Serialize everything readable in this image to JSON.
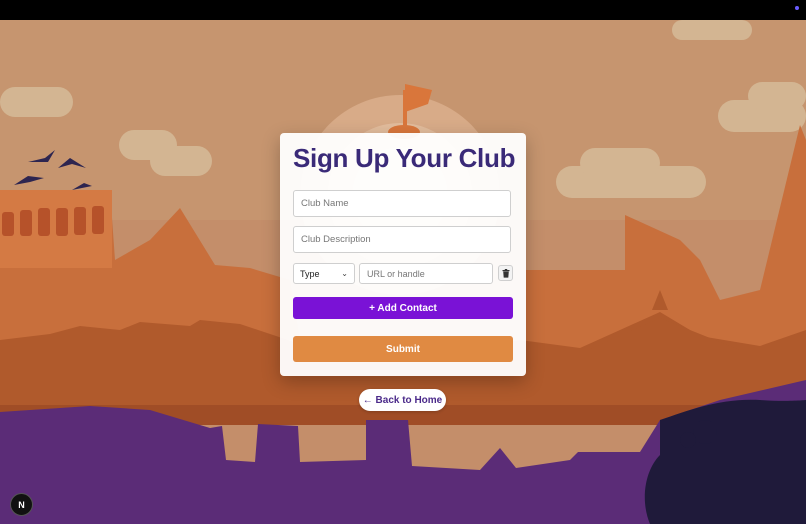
{
  "form": {
    "title": "Sign Up Your Club",
    "club_name_placeholder": "Club Name",
    "club_description_placeholder": "Club Description",
    "contact_type_selected": "Type",
    "contact_url_placeholder": "URL or handle",
    "add_contact_label": "+ Add Contact",
    "submit_label": "Submit"
  },
  "nav": {
    "back_label": "← Back to Home"
  },
  "dev_badge": {
    "label": "N"
  },
  "colors": {
    "accent_purple": "#7a12d6",
    "submit_orange": "#e08a42",
    "title_color": "#3a2a78"
  }
}
